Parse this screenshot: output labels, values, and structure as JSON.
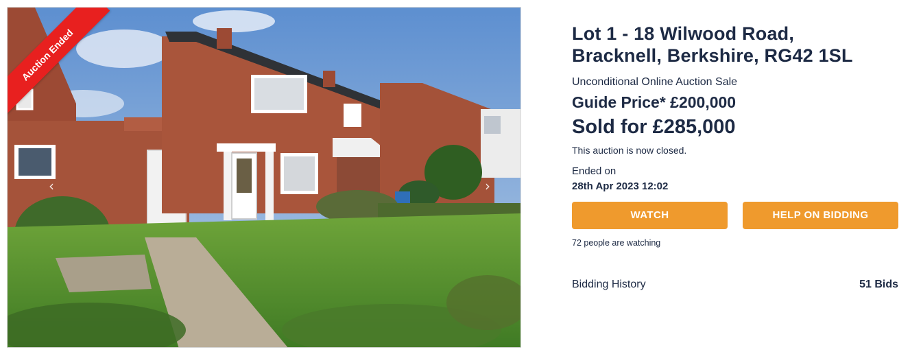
{
  "listing": {
    "badge": "Auction Ended",
    "title_line1": "Lot 1 - 18 Wilwood Road,",
    "title_line2": "Bracknell, Berkshire, RG42 1SL",
    "sale_type": "Unconditional Online Auction Sale",
    "guide_price": "Guide Price* £200,000",
    "sold_price": "Sold for £285,000",
    "status": "This auction is now closed.",
    "ended_label": "Ended on",
    "ended_date": "28th Apr 2023 12:02"
  },
  "actions": {
    "watch": "WATCH",
    "help": "HELP ON BIDDING",
    "watching": "72 people are watching"
  },
  "bidding": {
    "label": "Bidding History",
    "count": "51 Bids"
  },
  "gallery": {
    "prev_icon": "‹",
    "next_icon": "›"
  },
  "colors": {
    "accent": "#ef9a2d",
    "ribbon": "#e8201f",
    "text": "#1d2a44"
  }
}
